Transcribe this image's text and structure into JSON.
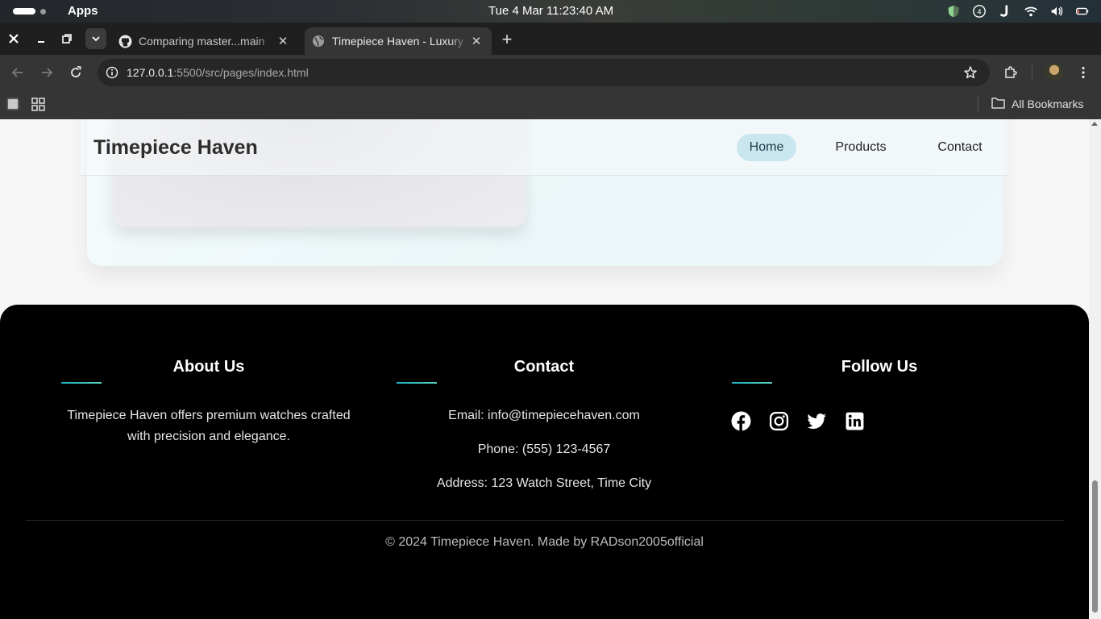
{
  "os_bar": {
    "apps_label": "Apps",
    "clock": "Tue 4 Mar  11:23:40 AM",
    "tray_icons": [
      "shield-icon",
      "notification-count-icon",
      "j-app-icon",
      "wifi-icon",
      "volume-icon",
      "battery-icon"
    ],
    "notification_count": "4"
  },
  "browser": {
    "tabs": [
      {
        "title": "Comparing master...main",
        "icon": "github-icon",
        "active": false
      },
      {
        "title": "Timepiece Haven - Luxury",
        "icon": "globe-icon",
        "active": true
      }
    ],
    "address": {
      "host": "127.0.0.1",
      "rest": ":5500/src/pages/index.html"
    },
    "bookmarks_label": "All Bookmarks"
  },
  "site": {
    "brand": "Timepiece Haven",
    "nav": [
      {
        "label": "Home",
        "active": true
      },
      {
        "label": "Products",
        "active": false
      },
      {
        "label": "Contact",
        "active": false
      }
    ]
  },
  "footer": {
    "about": {
      "title": "About Us",
      "text": "Timepiece Haven offers premium watches crafted with precision and elegance."
    },
    "contact": {
      "title": "Contact",
      "email": "Email: info@timepiecehaven.com",
      "phone": "Phone: (555) 123-4567",
      "address": "Address: 123 Watch Street, Time City"
    },
    "follow": {
      "title": "Follow Us",
      "networks": [
        "facebook-icon",
        "instagram-icon",
        "twitter-icon",
        "linkedin-icon"
      ]
    },
    "copyright": "© 2024 Timepiece Haven. Made by RADson2005official"
  },
  "colors": {
    "accent_line": "#1db0c0",
    "nav_active_bg": "#c9e6ee",
    "footer_bg": "#000000"
  }
}
